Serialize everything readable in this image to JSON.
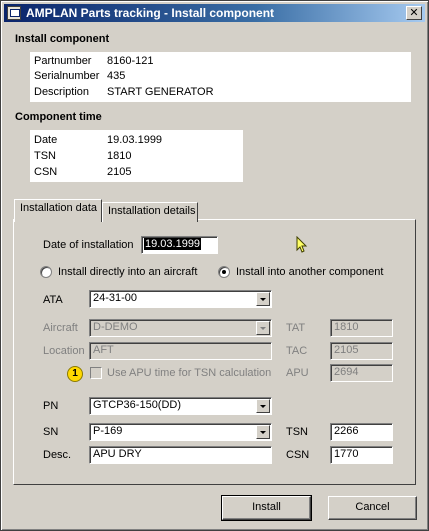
{
  "window": {
    "title": "AMPLAN Parts tracking - Install component"
  },
  "install_component": {
    "heading": "Install component",
    "fields": [
      {
        "label": "Partnumber",
        "value": "8160-121"
      },
      {
        "label": "Serialnumber",
        "value": "435"
      },
      {
        "label": "Description",
        "value": "START GENERATOR"
      }
    ]
  },
  "component_time": {
    "heading": "Component time",
    "fields": [
      {
        "label": "Date",
        "value": "19.03.1999"
      },
      {
        "label": "TSN",
        "value": "1810"
      },
      {
        "label": "CSN",
        "value": "2105"
      }
    ]
  },
  "tabs": [
    {
      "label": "Installation data",
      "active": true
    },
    {
      "label": "Installation details",
      "active": false
    }
  ],
  "installation": {
    "date_label": "Date of installation",
    "date_value": "19.03.1999",
    "radio_aircraft": "Install directly into an aircraft",
    "radio_component": "Install into another component",
    "radio_selected": "component",
    "ata_label": "ATA",
    "ata_value": "24-31-00",
    "aircraft_label": "Aircraft",
    "aircraft_value": "D-DEMO",
    "location_label": "Location",
    "location_value": "AFT",
    "tat_label": "TAT",
    "tat_value": "1810",
    "tac_label": "TAC",
    "tac_value": "2105",
    "apu_label": "APU",
    "apu_value": "2694",
    "badge": "1",
    "use_apu_label": "Use APU time for TSN calculation",
    "pn_label": "PN",
    "pn_value": "GTCP36-150(DD)",
    "sn_label": "SN",
    "sn_value": "P-169",
    "desc_label": "Desc.",
    "desc_value": "APU DRY",
    "tsn_label": "TSN",
    "tsn_value": "2266",
    "csn_label": "CSN",
    "csn_value": "1770"
  },
  "buttons": {
    "install": "Install",
    "cancel": "Cancel"
  },
  "colors": {
    "title_bar": "#0a246a",
    "dialog_face": "#d4d0c8",
    "badge": "#ffd800"
  }
}
